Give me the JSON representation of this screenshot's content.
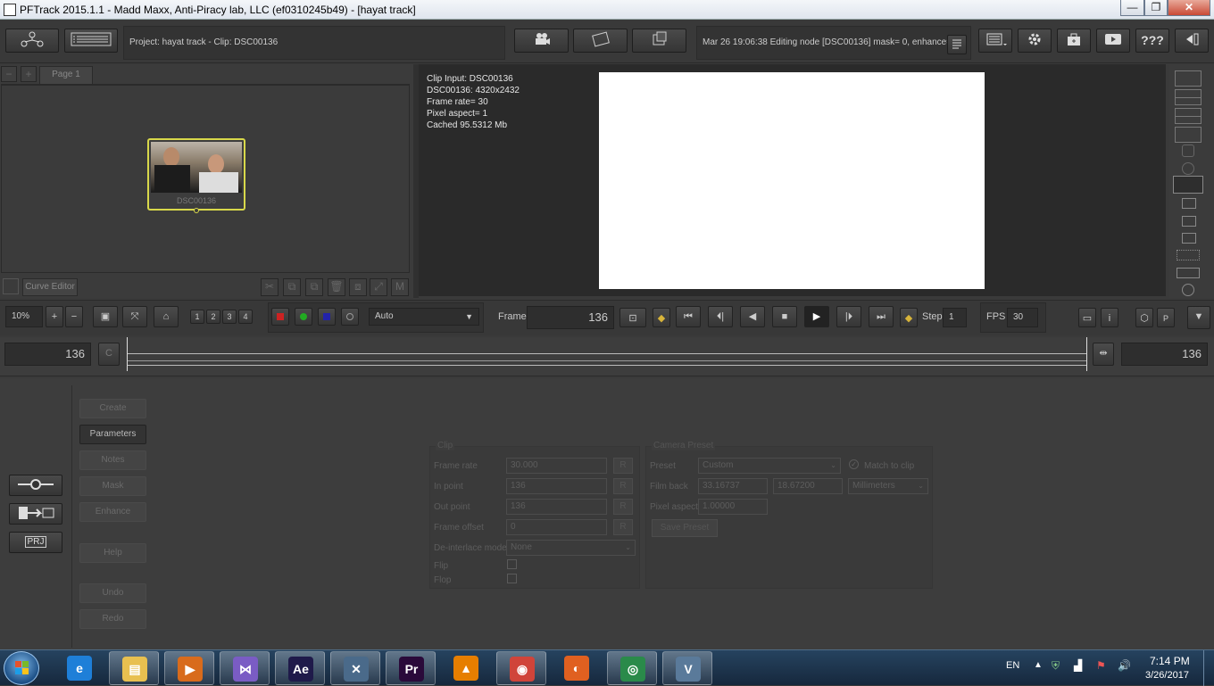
{
  "window": {
    "title": "PFTrack 2015.1.1 - Madd Maxx, Anti-Piracy lab, LLC (ef0310245b49) - [hayat track]",
    "min": "—",
    "max": "❐",
    "close": "✕"
  },
  "toolbar": {
    "project_label": "Project: hayat track - Clip: DSC00136",
    "status_message": "Mar 26 19:06:38 Editing node [DSC00136] mask= 0, enhance= 0",
    "help_label": "???"
  },
  "node_editor": {
    "page_tab": "Page 1",
    "node_label": "DSC00136",
    "curve_editor_label": "Curve Editor"
  },
  "viewer": {
    "info": [
      "Clip Input: DSC00136",
      "DSC00136: 4320x2432",
      "Frame rate= 30",
      "Pixel aspect= 1",
      "Cached 95.5312 Mb"
    ]
  },
  "transport": {
    "zoom": "10%",
    "channels": [
      "1",
      "2",
      "3",
      "4"
    ],
    "display_mode": "Auto",
    "frame_label": "Frame",
    "frame_value": "136",
    "step_label": "Step",
    "step_value": "1",
    "fps_label": "FPS",
    "fps_value": "30",
    "p_label": "P"
  },
  "timeline": {
    "start_frame": "136",
    "end_frame": "136",
    "c_label": "C"
  },
  "side_buttons": {
    "create": "Create",
    "parameters": "Parameters",
    "notes": "Notes",
    "mask": "Mask",
    "enhance": "Enhance",
    "help": "Help",
    "undo": "Undo",
    "redo": "Redo",
    "prj": "PRJ"
  },
  "clip_group": {
    "title": "Clip",
    "frame_rate_label": "Frame rate",
    "frame_rate_value": "30.000",
    "in_point_label": "In point",
    "in_point_value": "136",
    "out_point_label": "Out point",
    "out_point_value": "136",
    "frame_offset_label": "Frame offset",
    "frame_offset_value": "0",
    "deinterlace_label": "De-interlace mode",
    "deinterlace_value": "None",
    "flip_label": "Flip",
    "flop_label": "Flop",
    "r_label": "R"
  },
  "camera_group": {
    "title": "Camera Preset",
    "preset_label": "Preset",
    "preset_value": "Custom",
    "match_label": "Match to clip",
    "film_back_label": "Film back",
    "film_back_w": "33.16737",
    "film_back_h": "18.67200",
    "units_value": "Millimeters",
    "pixel_aspect_label": "Pixel aspect",
    "pixel_aspect_value": "1.00000",
    "save_preset": "Save Preset"
  },
  "taskbar": {
    "lang": "EN",
    "time": "7:14 PM",
    "date": "3/26/2017",
    "apps": [
      {
        "name": "internet-explorer",
        "glyph": "e",
        "color": "#1e7fd8"
      },
      {
        "name": "file-explorer",
        "glyph": "▤",
        "color": "#e8c050"
      },
      {
        "name": "media-player",
        "glyph": "▶",
        "color": "#d86b1c"
      },
      {
        "name": "visual-studio",
        "glyph": "⋈",
        "color": "#7a5cc4"
      },
      {
        "name": "after-effects",
        "glyph": "Ae",
        "color": "#1f1a4a"
      },
      {
        "name": "pftrack",
        "glyph": "✕",
        "color": "#4a6a8a"
      },
      {
        "name": "premiere",
        "glyph": "Pr",
        "color": "#2a0a3a"
      },
      {
        "name": "vlc",
        "glyph": "▲",
        "color": "#e67e00"
      },
      {
        "name": "chrome",
        "glyph": "◉",
        "color": "#d0443a"
      },
      {
        "name": "firefox",
        "glyph": "◐",
        "color": "#e06020"
      },
      {
        "name": "network-app",
        "glyph": "◎",
        "color": "#2a8a4a"
      },
      {
        "name": "vegas",
        "glyph": "V",
        "color": "#5a7a9a"
      }
    ]
  }
}
